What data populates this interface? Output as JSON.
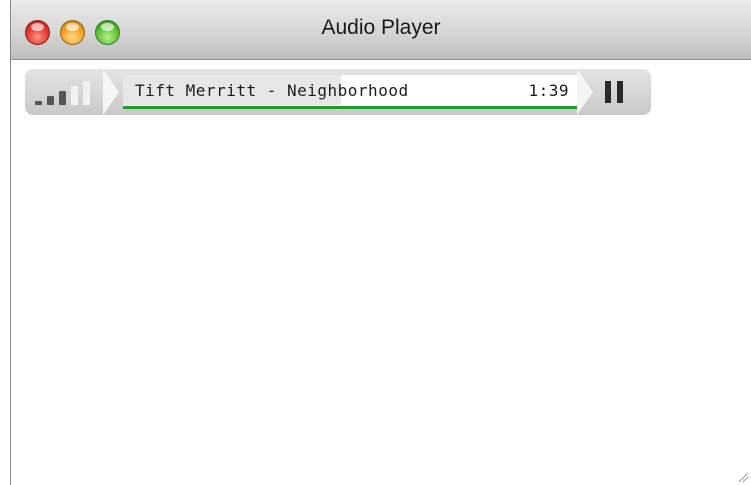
{
  "window": {
    "title": "Audio Player"
  },
  "player": {
    "track_title": "Tift Merritt - Neighborhood",
    "elapsed_time": "1:39",
    "playback_state": "playing",
    "played_fraction": 0.48,
    "loaded_fraction": 1.0,
    "volume_level_bars": 3,
    "volume_total_bars": 5,
    "icons": {
      "volume": "volume-bars-icon",
      "pause": "pause-icon"
    },
    "colors": {
      "load_bar": "#1e9b2a"
    }
  }
}
